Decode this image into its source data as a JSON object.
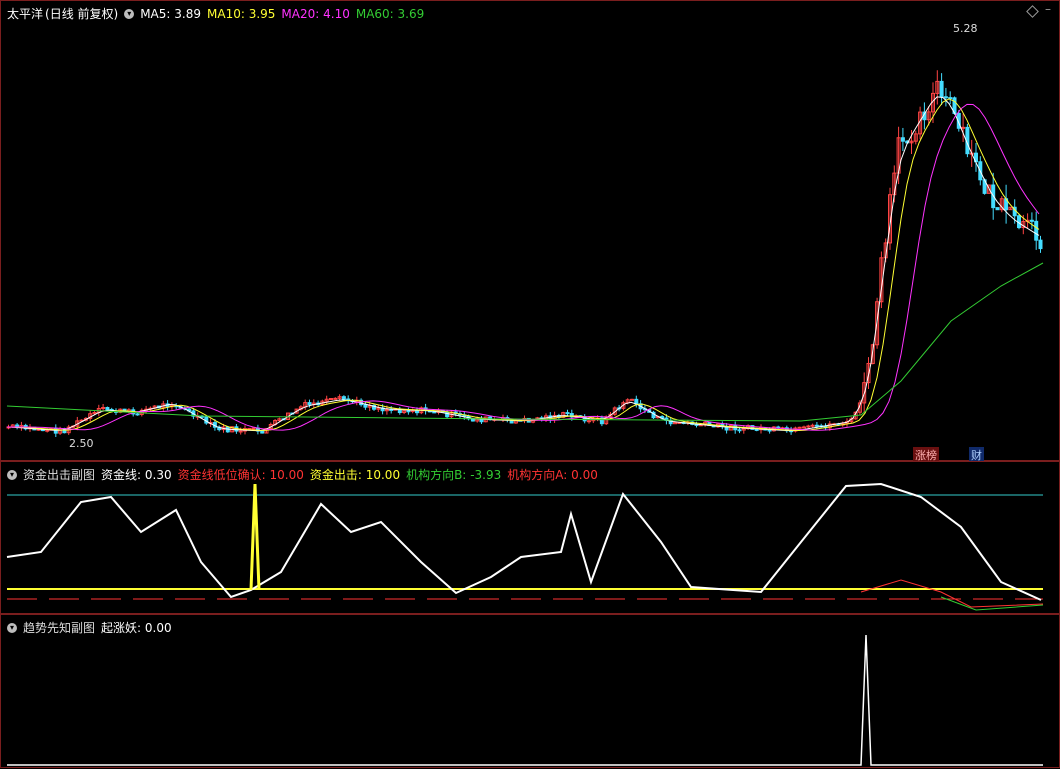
{
  "main": {
    "stock_name": "太平洋",
    "period": "(日线 前复权)",
    "ma": [
      {
        "label": "MA5:",
        "value": "3.89",
        "color": "#ffffff"
      },
      {
        "label": "MA10:",
        "value": "3.95",
        "color": "#ffff33"
      },
      {
        "label": "MA20:",
        "value": "4.10",
        "color": "#ff33ff"
      },
      {
        "label": "MA60:",
        "value": "3.69",
        "color": "#33cc33"
      }
    ],
    "high_marker": "5.28",
    "low_marker": "2.50",
    "tag_limit_up": "涨榜",
    "tag_finance": "财"
  },
  "ind1": {
    "title": "资金出击副图",
    "items": [
      {
        "label": "资金线:",
        "value": "0.30",
        "color": "#ffffff"
      },
      {
        "label": "资金线低位确认:",
        "value": "10.00",
        "color": "#ff3333"
      },
      {
        "label": "资金出击:",
        "value": "10.00",
        "color": "#ffff33"
      },
      {
        "label": "机构方向B:",
        "value": "-3.93",
        "color": "#33cc33"
      },
      {
        "label": "机构方向A:",
        "value": "0.00",
        "color": "#ff3333"
      }
    ]
  },
  "ind2": {
    "title": "趋势先知副图",
    "items": [
      {
        "label": "起涨妖:",
        "value": "0.00",
        "color": "#ffffff"
      }
    ]
  },
  "colors": {
    "up": "#ff4444",
    "down": "#44ddff",
    "frame": "#7a1e1e"
  }
}
